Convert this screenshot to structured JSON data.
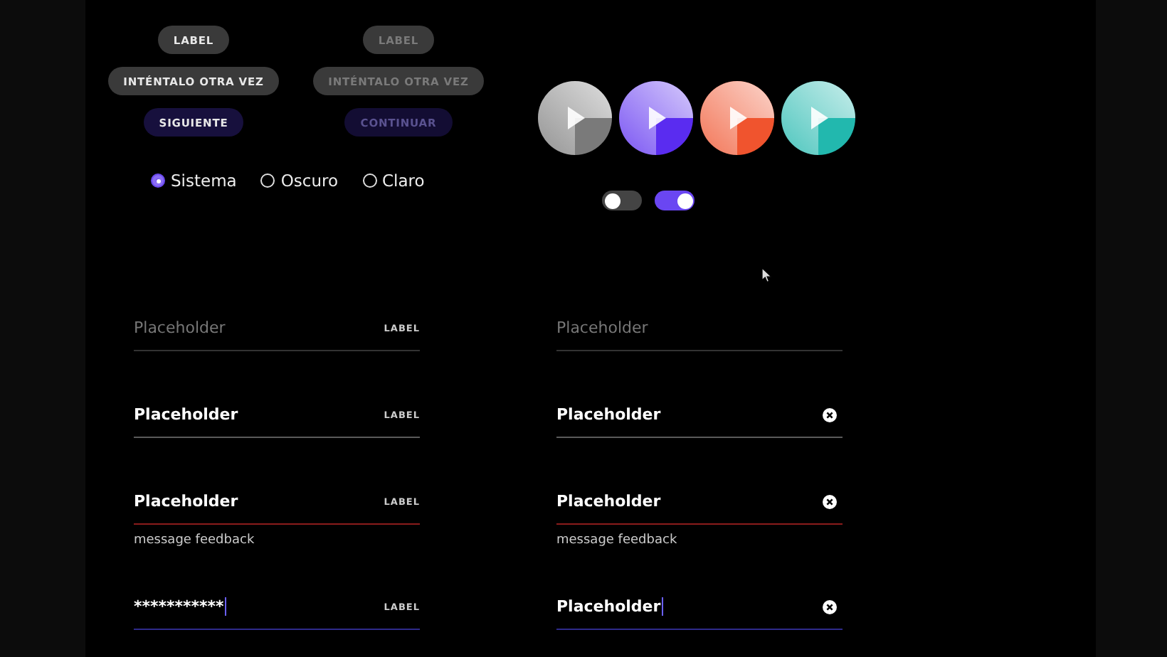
{
  "button_columns": [
    [
      {
        "label": "LABEL",
        "kind": "secondary",
        "disabled": false
      },
      {
        "label": "INTÉNTALO OTRA VEZ",
        "kind": "secondary",
        "disabled": false
      },
      {
        "label": "SIGUIENTE",
        "kind": "primary",
        "disabled": false
      }
    ],
    [
      {
        "label": "LABEL",
        "kind": "secondary",
        "disabled": true
      },
      {
        "label": "INTÉNTALO OTRA VEZ",
        "kind": "secondary",
        "disabled": true
      },
      {
        "label": "CONTINUAR",
        "kind": "primary",
        "disabled": true
      }
    ]
  ],
  "theme_options": [
    {
      "label": "Sistema",
      "selected": true
    },
    {
      "label": "Oscuro",
      "selected": false
    },
    {
      "label": "Claro",
      "selected": false
    }
  ],
  "play_buttons": [
    {
      "color": "#7a7a7a"
    },
    {
      "color": "#5a2cf0"
    },
    {
      "color": "#f0542e"
    },
    {
      "color": "#22b8ae"
    }
  ],
  "toggles": [
    {
      "on": false
    },
    {
      "on": true
    }
  ],
  "field_columns": [
    [
      {
        "placeholder": "Placeholder",
        "label": "LABEL",
        "clear": false,
        "error": false,
        "focused": false
      },
      {
        "value": "Placeholder",
        "label": "LABEL",
        "clear": false,
        "error": false,
        "focused": false
      },
      {
        "value": "Placeholder",
        "label": "LABEL",
        "clear": false,
        "error": true,
        "focused": false,
        "feedback": "message feedback"
      },
      {
        "value": "***********",
        "label": "LABEL",
        "clear": false,
        "error": false,
        "focused": true
      }
    ],
    [
      {
        "placeholder": "Placeholder",
        "clear": false,
        "error": false,
        "focused": false
      },
      {
        "value": "Placeholder",
        "clear": true,
        "error": false,
        "focused": false
      },
      {
        "value": "Placeholder",
        "clear": true,
        "error": true,
        "focused": false,
        "feedback": "message feedback"
      },
      {
        "value": "Placeholder",
        "clear": true,
        "error": false,
        "focused": true
      }
    ]
  ]
}
